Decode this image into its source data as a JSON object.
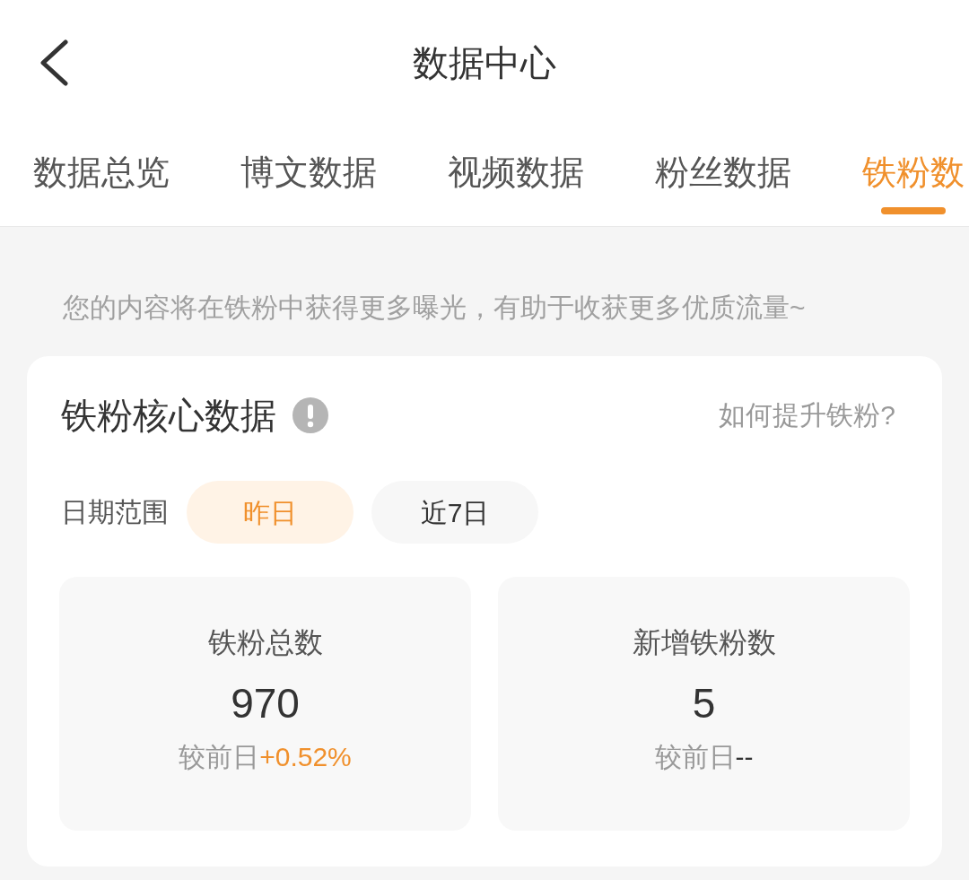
{
  "header": {
    "title": "数据中心"
  },
  "tabs": [
    {
      "label": "数据总览",
      "selected": false
    },
    {
      "label": "博文数据",
      "selected": false
    },
    {
      "label": "视频数据",
      "selected": false
    },
    {
      "label": "粉丝数据",
      "selected": false
    },
    {
      "label": "铁粉数",
      "selected": true
    }
  ],
  "notice": "您的内容将在铁粉中获得更多曝光，有助于收获更多优质流量~",
  "core_data": {
    "title": "铁粉核心数据",
    "help_link": "如何提升铁粉?",
    "date_range": {
      "label": "日期范围",
      "options": [
        {
          "label": "昨日",
          "selected": true
        },
        {
          "label": "近7日",
          "selected": false
        }
      ]
    },
    "stats": [
      {
        "label": "铁粉总数",
        "value": "970",
        "compare_label": "较前日",
        "change": "+0.52%",
        "color": "#f0902c"
      },
      {
        "label": "新增铁粉数",
        "value": "5",
        "compare_label": "较前日",
        "change": "--",
        "color": "#333333"
      }
    ]
  }
}
